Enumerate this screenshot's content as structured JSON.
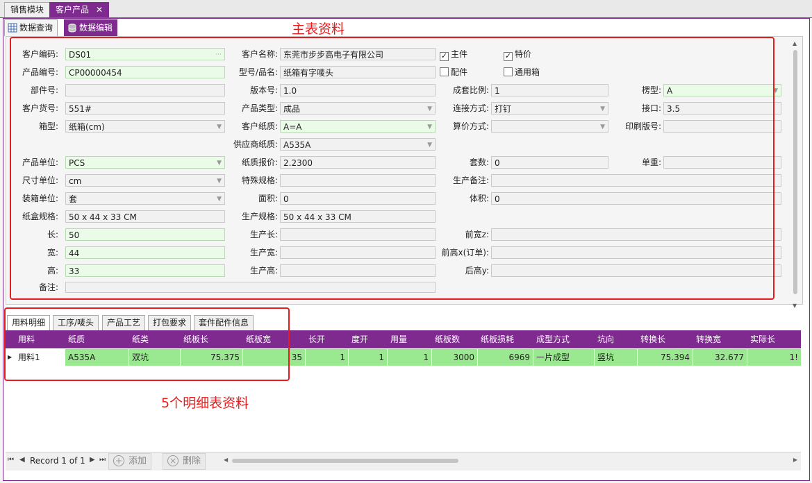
{
  "top_tabs": [
    {
      "label": "销售模块"
    },
    {
      "label": "客户产品",
      "close": "✕"
    }
  ],
  "sub_tabs": [
    {
      "label": "数据查询"
    },
    {
      "label": "数据编辑"
    }
  ],
  "annotations": {
    "master": "主表资料",
    "detail": "5个明细表资料"
  },
  "form": {
    "customer_code": {
      "label": "客户编码:",
      "value": "DS01",
      "ellipsis": "···"
    },
    "customer_name": {
      "label": "客户名称:",
      "value": "东莞市步步高电子有限公司"
    },
    "main_part": {
      "label": "主件",
      "checked": "✓"
    },
    "special_price": {
      "label": "特价",
      "checked": "✓"
    },
    "product_no": {
      "label": "产品编号:",
      "value": "CP00000454"
    },
    "model_name": {
      "label": "型号/品名:",
      "value": "纸箱有字唛头"
    },
    "accessory": {
      "label": "配件"
    },
    "universal_box": {
      "label": "通用箱"
    },
    "part_no": {
      "label": "部件号:",
      "value": ""
    },
    "version_no": {
      "label": "版本号:",
      "value": "1.0"
    },
    "set_ratio": {
      "label": "成套比例:",
      "value": "1"
    },
    "flute_type": {
      "label": "楞型:",
      "value": "A"
    },
    "customer_item_no": {
      "label": "客户货号:",
      "value": "551#"
    },
    "product_type": {
      "label": "产品类型:",
      "value": "成品"
    },
    "joint_method": {
      "label": "连接方式:",
      "value": "打钉"
    },
    "joint": {
      "label": "接口:",
      "value": "3.5"
    },
    "box_type": {
      "label": "箱型:",
      "value": "纸箱(cm)"
    },
    "customer_paper": {
      "label": "客户纸质:",
      "value": "A=A"
    },
    "pricing_method": {
      "label": "算价方式:",
      "value": ""
    },
    "print_plate_no": {
      "label": "印刷版号:",
      "value": ""
    },
    "supplier_paper": {
      "label": "供应商纸质:",
      "value": "A535A"
    },
    "product_unit": {
      "label": "产品单位:",
      "value": "PCS"
    },
    "paper_quote": {
      "label": "纸质报价:",
      "value": "2.2300"
    },
    "set_count": {
      "label": "套数:",
      "value": "0"
    },
    "unit_weight": {
      "label": "单重:",
      "value": ""
    },
    "size_unit": {
      "label": "尺寸单位:",
      "value": "cm"
    },
    "special_spec": {
      "label": "特殊规格:",
      "value": ""
    },
    "production_note": {
      "label": "生产备注:",
      "value": ""
    },
    "packing_unit": {
      "label": "装箱单位:",
      "value": "套"
    },
    "area": {
      "label": "面积:",
      "value": "0"
    },
    "volume": {
      "label": "体积:",
      "value": "0"
    },
    "carton_spec": {
      "label": "纸盒规格:",
      "value": "50 x 44 x 33 CM"
    },
    "production_spec": {
      "label": "生产规格:",
      "value": "50 x 44 x 33 CM"
    },
    "length": {
      "label": "长:",
      "value": "50"
    },
    "prod_length": {
      "label": "生产长:",
      "value": ""
    },
    "front_width": {
      "label": "前宽z:",
      "value": ""
    },
    "width": {
      "label": "宽:",
      "value": "44"
    },
    "prod_width": {
      "label": "生产宽:",
      "value": ""
    },
    "front_height": {
      "label": "前高x(订单):",
      "value": ""
    },
    "height": {
      "label": "高:",
      "value": "33"
    },
    "prod_height": {
      "label": "生产高:",
      "value": ""
    },
    "rear_height": {
      "label": "后高y:",
      "value": ""
    },
    "remark": {
      "label": "备注:",
      "value": ""
    }
  },
  "detail_tabs": [
    "用料明细",
    "工序/唛头",
    "产品工艺",
    "打包要求",
    "套件配件信息"
  ],
  "grid": {
    "columns": [
      "用料",
      "纸质",
      "纸类",
      "纸板长",
      "纸板宽",
      "长开",
      "度开",
      "用量",
      "纸板数",
      "纸板损耗",
      "成型方式",
      "坑向",
      "转换长",
      "转换宽",
      "实际长"
    ],
    "row": [
      "用料1",
      "A535A",
      "双坑",
      "75.375",
      "35",
      "1",
      "1",
      "1",
      "3000",
      "6969",
      "一片成型",
      "竖坑",
      "75.394",
      "32.677",
      "1!"
    ]
  },
  "navigator": {
    "record": "Record 1 of 1",
    "add": "添加",
    "delete": "删除"
  },
  "colors": {
    "accent": "#7e2a8f",
    "annotation": "#e81c1c",
    "row_highlight": "#9ae88f",
    "required_field": "#eafbe8"
  }
}
